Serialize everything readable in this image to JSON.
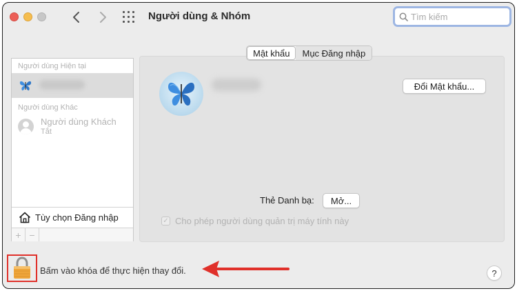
{
  "window": {
    "title": "Người dùng & Nhóm"
  },
  "search": {
    "placeholder": "Tìm kiếm"
  },
  "sidebar": {
    "current_users_label": "Người dùng Hiện tại",
    "other_users_label": "Người dùng Khác",
    "guest": {
      "name": "Người dùng Khách",
      "status": "Tắt"
    },
    "login_options_label": "Tùy chọn Đăng nhập",
    "add_symbol": "+",
    "remove_symbol": "−"
  },
  "tabs": [
    {
      "label": "Mật khẩu",
      "active": true
    },
    {
      "label": "Mục Đăng nhập",
      "active": false
    }
  ],
  "main": {
    "change_password_label": "Đổi Mật khẩu...",
    "contacts_card_label": "Thẻ Danh bạ:",
    "open_label": "Mở...",
    "admin_checkbox_label": "Cho phép người dùng quản trị máy tính này",
    "admin_checked": true
  },
  "footer": {
    "lock_text": "Bấm vào khóa để thực hiện thay đổi.",
    "help_label": "?"
  },
  "icons": {
    "back": "chevron-left-icon",
    "forward": "chevron-right-icon",
    "show_all": "grid-icon",
    "search": "search-icon",
    "lock": "lock-icon",
    "house": "house-icon"
  },
  "colors": {
    "highlight_red": "#e0302a",
    "search_focus": "#9db6e3",
    "butterfly_blue": "#3f8ee0"
  }
}
